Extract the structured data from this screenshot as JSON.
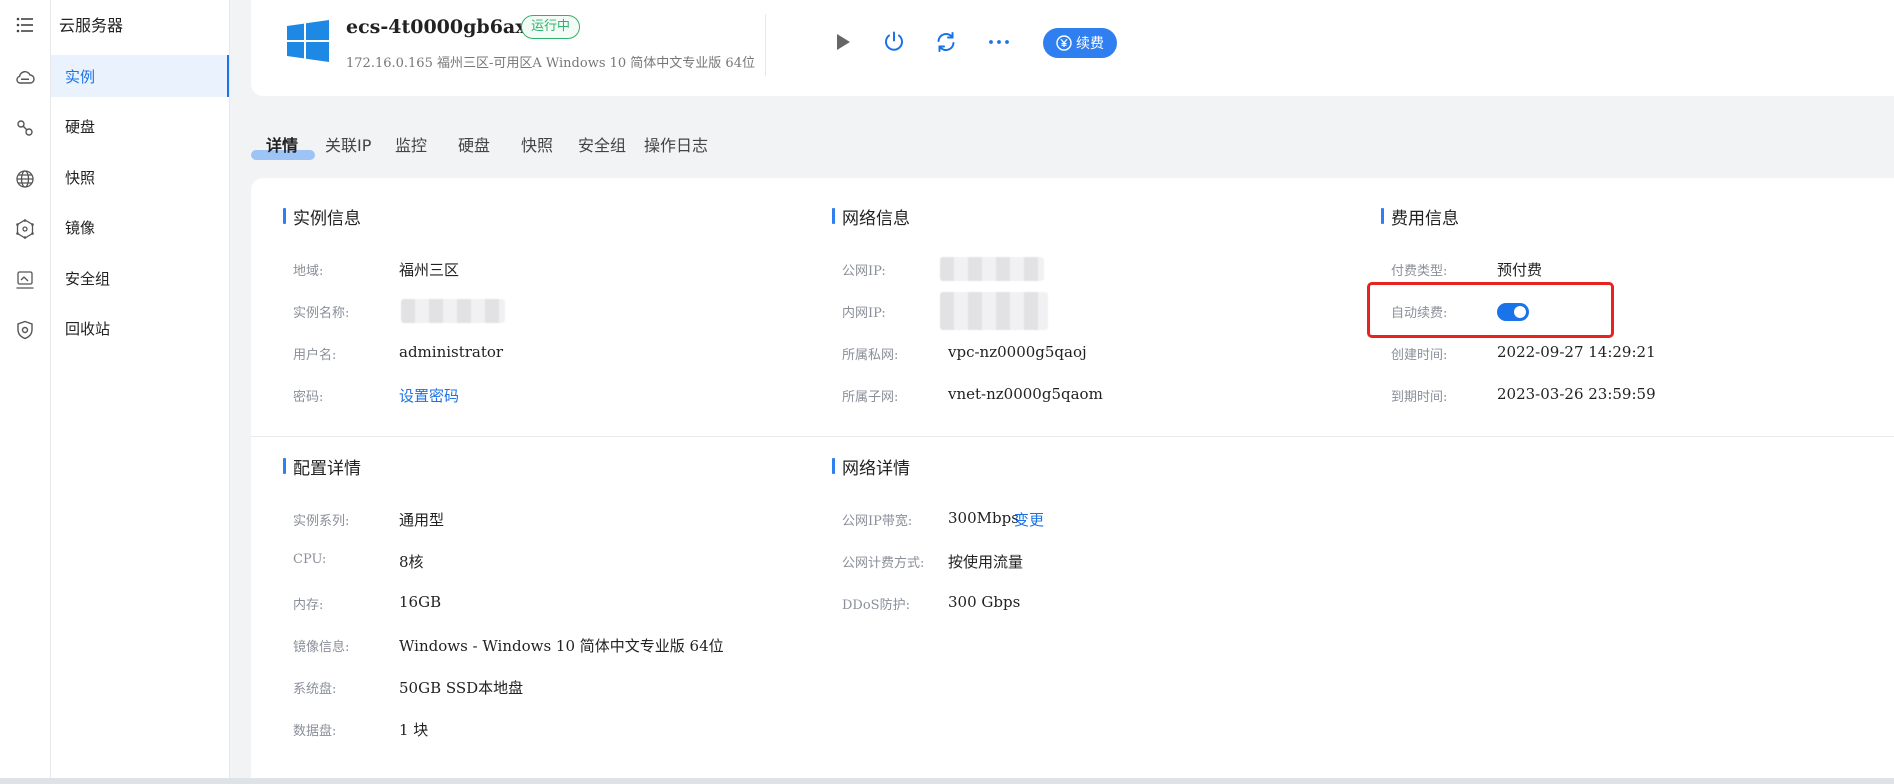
{
  "rail": {
    "items": [
      {
        "name": "list-icon"
      },
      {
        "name": "cloud-icon"
      },
      {
        "name": "disk-icon"
      },
      {
        "name": "globe-icon"
      },
      {
        "name": "network-icon"
      },
      {
        "name": "image-icon"
      },
      {
        "name": "shield-icon"
      }
    ]
  },
  "menu": {
    "title": "云服务器",
    "items": [
      {
        "label": "实例",
        "active": true
      },
      {
        "label": "硬盘"
      },
      {
        "label": "快照"
      },
      {
        "label": "镜像"
      },
      {
        "label": "安全组"
      },
      {
        "label": "回收站"
      }
    ]
  },
  "header": {
    "instance_name": "ecs-4t0000gb6axm",
    "status": "运行中",
    "meta": "172.16.0.165  福州三区-可用区A  Windows 10 简体中文专业版 64位",
    "actions": [
      "play-icon",
      "power-icon",
      "refresh-icon",
      "more-icon"
    ],
    "renew_label": "续费"
  },
  "tabs": [
    "详情",
    "关联IP",
    "监控",
    "硬盘",
    "快照",
    "安全组",
    "操作日志"
  ],
  "sections": {
    "instance_info": {
      "title": "实例信息",
      "rows": [
        {
          "label": "地域:",
          "value": "福州三区"
        },
        {
          "label": "实例名称:",
          "value": ""
        },
        {
          "label": "用户名:",
          "value": "administrator"
        },
        {
          "label": "密码:",
          "value": "设置密码"
        }
      ]
    },
    "network_info": {
      "title": "网络信息",
      "rows": [
        {
          "label": "公网IP:",
          "value": ""
        },
        {
          "label": "内网IP:",
          "value": ""
        },
        {
          "label": "所属私网:",
          "value": "vpc-nz0000g5qaoj"
        },
        {
          "label": "所属子网:",
          "value": "vnet-nz0000g5qaom"
        }
      ]
    },
    "billing_info": {
      "title": "费用信息",
      "rows": [
        {
          "label": "付费类型:",
          "value": "预付费"
        },
        {
          "label": "自动续费:",
          "value": ""
        },
        {
          "label": "创建时间:",
          "value": "2022-09-27 14:29:21"
        },
        {
          "label": "到期时间:",
          "value": "2023-03-26 23:59:59"
        }
      ],
      "auto_renew_enabled": true
    },
    "config_details": {
      "title": "配置详情",
      "rows": [
        {
          "label": "实例系列:",
          "value": "通用型"
        },
        {
          "label": "CPU:",
          "value": "8核"
        },
        {
          "label": "内存:",
          "value": "16GB"
        },
        {
          "label": "镜像信息:",
          "value": "Windows - Windows 10 简体中文专业版 64位"
        },
        {
          "label": "系统盘:",
          "value": "50GB SSD本地盘"
        },
        {
          "label": "数据盘:",
          "value": "1 块"
        }
      ]
    },
    "network_details": {
      "title": "网络详情",
      "rows": [
        {
          "label": "公网IP带宽:",
          "value": "300Mbps",
          "link": "变更"
        },
        {
          "label": "公网计费方式:",
          "value": "按使用流量"
        },
        {
          "label": "DDoS防护:",
          "value": "300 Gbps"
        }
      ]
    }
  },
  "colors": {
    "accent": "#1a73e8",
    "status_green": "#2fb36a",
    "highlight_red": "#e8231f"
  }
}
